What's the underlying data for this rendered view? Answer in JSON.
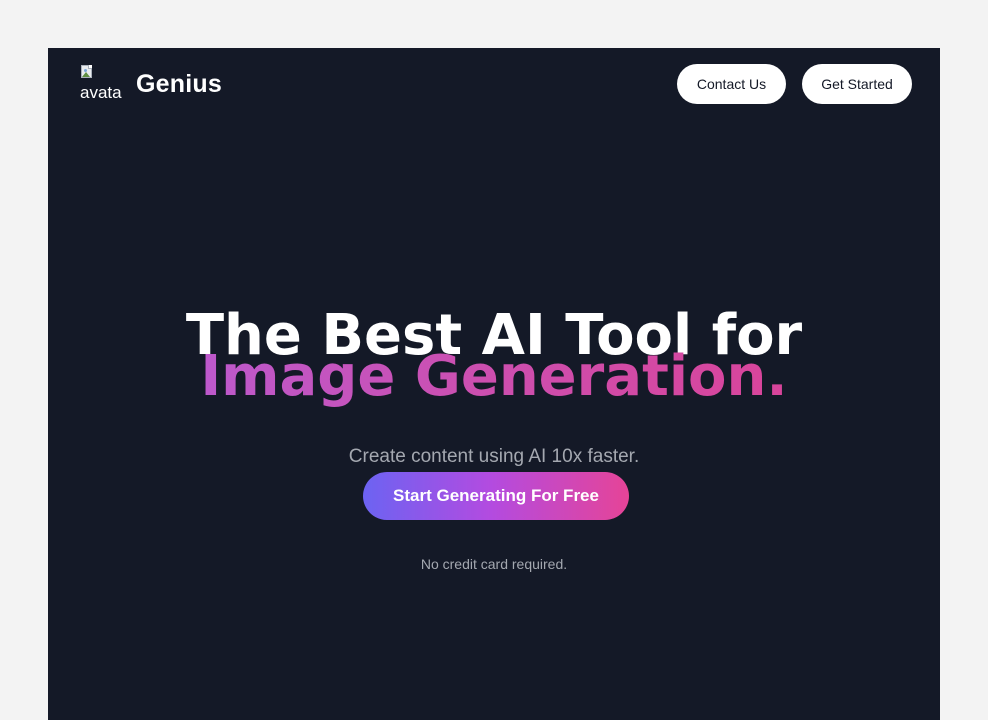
{
  "navbar": {
    "logo_alt": "avata",
    "brand": "Genius",
    "contact_label": "Contact Us",
    "get_started_label": "Get Started"
  },
  "hero": {
    "headline": "The Best AI Tool for",
    "gradient_headline": "Image Generation.",
    "subtitle": "Create content using AI 10x faster.",
    "cta_label": "Start Generating For Free",
    "note": "No credit card required."
  },
  "icons": {
    "logo": "broken-image-icon"
  },
  "colors": {
    "page_background": "#f3f3f3",
    "app_background": "#141927",
    "text_primary": "#ffffff",
    "text_muted": "#a4a8b0",
    "gradient_start": "#6c63f2",
    "gradient_middle": "#b34be0",
    "gradient_end": "#e64497"
  }
}
